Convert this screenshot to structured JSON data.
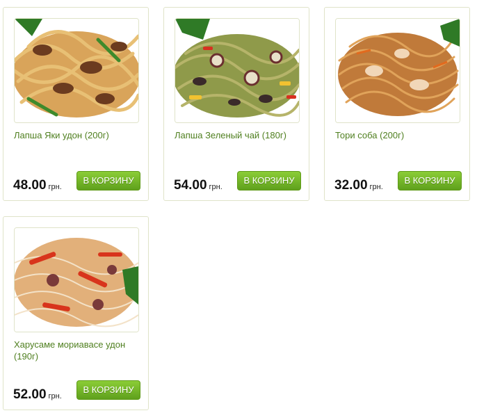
{
  "currency_label": "грн.",
  "buy_label": "В КОРЗИНУ",
  "products": [
    {
      "title": "Лапша Яки удон (200г)",
      "price": "48.00",
      "image": "udon-beef-noodles"
    },
    {
      "title": "Лапша Зеленый чай (180г)",
      "price": "54.00",
      "image": "green-tea-noodles-seafood"
    },
    {
      "title": "Тори соба (200г)",
      "price": "32.00",
      "image": "soba-chicken-noodles"
    },
    {
      "title": "Харусаме мориавасе удон (190г)",
      "price": "52.00",
      "image": "harusame-seafood-noodles"
    }
  ]
}
